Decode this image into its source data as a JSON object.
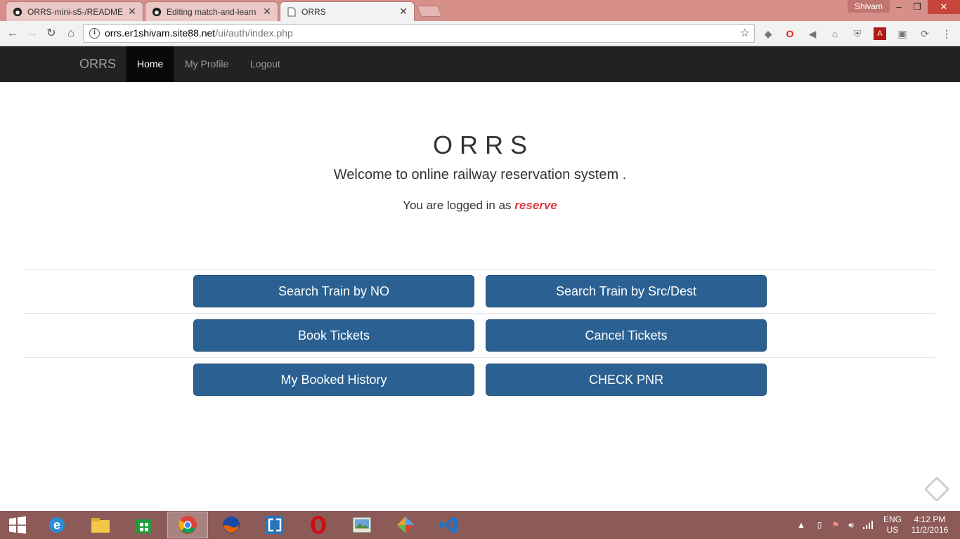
{
  "browser": {
    "tabs": [
      {
        "title": "ORRS-mini-s5-/README",
        "icon": "github-icon"
      },
      {
        "title": "Editing match-and-learn",
        "icon": "github-icon"
      },
      {
        "title": "ORRS",
        "icon": "page-icon"
      }
    ],
    "active_tab": 2,
    "profile_name": "Shivam",
    "address": {
      "host": "orrs.er1shivam.site88.net",
      "path": "/ui/auth/index.php"
    }
  },
  "site": {
    "brand": "ORRS",
    "nav": {
      "home": "Home",
      "profile": "My Profile",
      "logout": "Logout"
    },
    "heading": "ORRS",
    "welcome": "Welcome to online railway reservation system .",
    "logged_in_prefix": "You are logged in as",
    "username": "reserve",
    "buttons": {
      "search_no": "Search Train by NO",
      "search_src": "Search Train by Src/Dest",
      "book": "Book Tickets",
      "cancel": "Cancel Tickets",
      "history": "My Booked History",
      "pnr": "CHECK PNR"
    },
    "colors": {
      "button": "#2b6192",
      "username": "#e0393e",
      "navbar": "#222222"
    }
  },
  "taskbar": {
    "apps": [
      "windows-start-icon",
      "internet-explorer-icon",
      "file-explorer-icon",
      "windows-store-icon",
      "chrome-icon",
      "firefox-icon",
      "brackets-icon",
      "opera-icon",
      "photos-icon",
      "paint-icon",
      "vscode-icon"
    ],
    "language_top": "ENG",
    "language_bottom": "US",
    "time": "4:12 PM",
    "date": "11/2/2016"
  }
}
